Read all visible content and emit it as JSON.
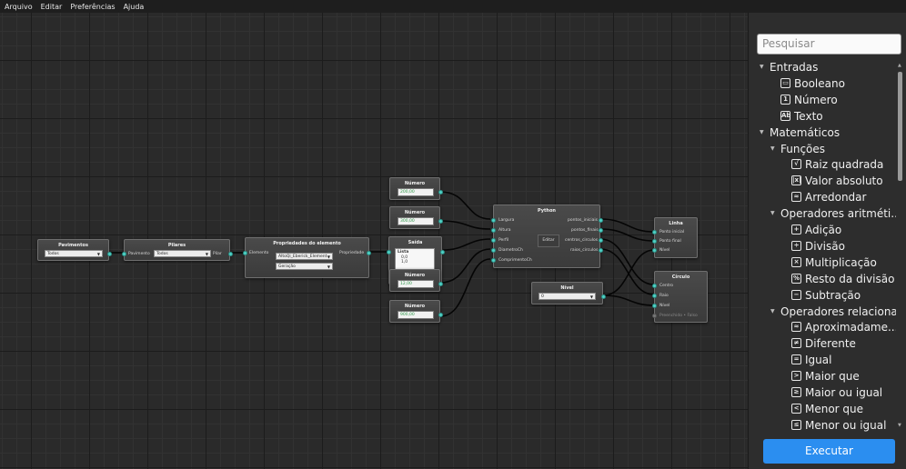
{
  "menu": [
    "Arquivo",
    "Editar",
    "Preferências",
    "Ajuda"
  ],
  "accent_color": "#4fd1c5",
  "run_button_color": "#2b8ef0",
  "nodes": {
    "pavimentos": {
      "title": "Pavimentos",
      "dropdown": "Todos"
    },
    "pilares": {
      "title": "Pilares",
      "in_label": "Pavimento",
      "dropdown": "Todos",
      "out_label": "Pilar"
    },
    "propriedades": {
      "title": "Propriedades do elemento",
      "in_label": "Elemento",
      "dropdown1": "AltoQi_Eberick_Element",
      "dropdown2": "Geração",
      "out_label": "Propriedade"
    },
    "numero1": {
      "title": "Número",
      "value": "200,00"
    },
    "numero2": {
      "title": "Número",
      "value": "300,00"
    },
    "saida": {
      "title": "Saída",
      "list_header": "Lista",
      "list_items": [
        "0,0",
        "1,0"
      ]
    },
    "numero3": {
      "title": "Número",
      "value": "12,00"
    },
    "numero4": {
      "title": "Número",
      "value": "900,00"
    },
    "python": {
      "title": "Python",
      "inputs": [
        "Largura",
        "Altura",
        "Perfil",
        "DiametroCh",
        "ComprimentoCh"
      ],
      "outputs": [
        "pontos_iniciais",
        "pontos_finais",
        "centros_circulos",
        "raios_circulos"
      ],
      "edit_label": "Editar"
    },
    "nivel": {
      "title": "Nível",
      "dropdown": "0"
    },
    "linha": {
      "title": "Linha",
      "inputs": [
        "Ponto inicial",
        "Ponto final",
        "Nível"
      ]
    },
    "circulo": {
      "title": "Círculo",
      "inputs": [
        "Centro",
        "Raio",
        "Nível",
        "Preenchido • Falso"
      ]
    }
  },
  "sidebar": {
    "search_placeholder": "Pesquisar",
    "tree": [
      {
        "label": "Entradas",
        "level": 0,
        "icon": "caret-down-icon"
      },
      {
        "label": "Booleano",
        "level": 2,
        "icon": "boolean-icon"
      },
      {
        "label": "Número",
        "level": 2,
        "icon": "number-icon"
      },
      {
        "label": "Texto",
        "level": 2,
        "icon": "text-icon"
      },
      {
        "label": "Matemáticos",
        "level": 0,
        "icon": "caret-down-icon"
      },
      {
        "label": "Funções",
        "level": 1,
        "icon": "caret-down-icon"
      },
      {
        "label": "Raiz quadrada",
        "level": 3,
        "icon": "sqrt-icon"
      },
      {
        "label": "Valor absoluto",
        "level": 3,
        "icon": "abs-icon"
      },
      {
        "label": "Arredondar",
        "level": 3,
        "icon": "round-icon"
      },
      {
        "label": "Operadores aritméti...",
        "level": 1,
        "icon": "caret-down-icon"
      },
      {
        "label": "Adição",
        "level": 3,
        "icon": "plus-icon"
      },
      {
        "label": "Divisão",
        "level": 3,
        "icon": "divide-icon"
      },
      {
        "label": "Multiplicação",
        "level": 3,
        "icon": "multiply-icon"
      },
      {
        "label": "Resto da divisão",
        "level": 3,
        "icon": "modulo-icon"
      },
      {
        "label": "Subtração",
        "level": 3,
        "icon": "minus-icon"
      },
      {
        "label": "Operadores relacionais",
        "level": 1,
        "icon": "caret-down-icon"
      },
      {
        "label": "Aproximadame...",
        "level": 3,
        "icon": "approx-icon"
      },
      {
        "label": "Diferente",
        "level": 3,
        "icon": "not-equal-icon"
      },
      {
        "label": "Igual",
        "level": 3,
        "icon": "equal-icon"
      },
      {
        "label": "Maior que",
        "level": 3,
        "icon": "greater-icon"
      },
      {
        "label": "Maior ou igual",
        "level": 3,
        "icon": "greater-equal-icon"
      },
      {
        "label": "Menor que",
        "level": 3,
        "icon": "less-icon"
      },
      {
        "label": "Menor ou igual",
        "level": 3,
        "icon": "less-equal-icon"
      }
    ],
    "run_label": "Executar"
  }
}
